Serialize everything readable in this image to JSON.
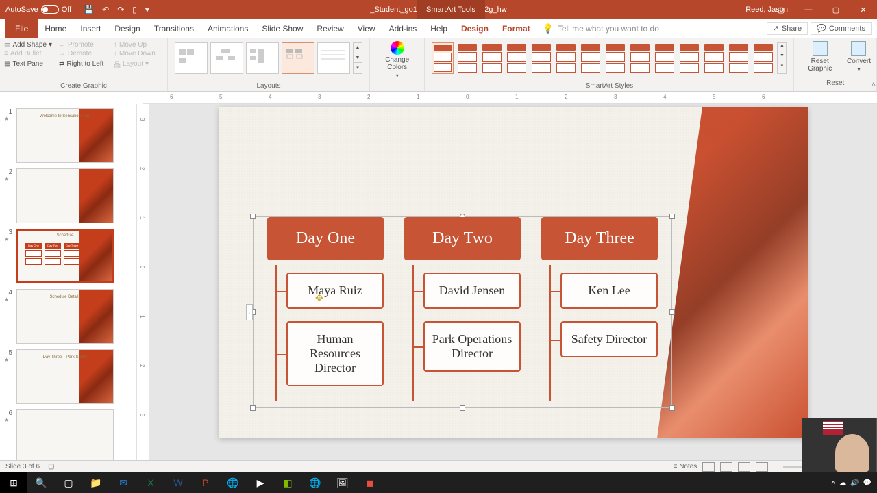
{
  "titlebar": {
    "autosave_label": "AutoSave",
    "autosave_state": "Off",
    "doc_name": "_Student_go16_pp_ch02_grader_2g_hw",
    "tools_tab": "SmartArt Tools",
    "user": "Reed, Jason"
  },
  "tabs": {
    "file": "File",
    "home": "Home",
    "insert": "Insert",
    "design": "Design",
    "transitions": "Transitions",
    "animations": "Animations",
    "slideshow": "Slide Show",
    "review": "Review",
    "view": "View",
    "addins": "Add-ins",
    "help": "Help",
    "ctx_design": "Design",
    "ctx_format": "Format",
    "tellme": "Tell me what you want to do",
    "share": "Share",
    "comments": "Comments"
  },
  "ribbon": {
    "create_graphic": {
      "label": "Create Graphic",
      "add_shape": "Add Shape",
      "add_bullet": "Add Bullet",
      "text_pane": "Text Pane",
      "promote": "Promote",
      "demote": "Demote",
      "rtl": "Right to Left",
      "move_up": "Move Up",
      "move_down": "Move Down",
      "layout": "Layout"
    },
    "layouts_label": "Layouts",
    "change_colors": "Change Colors",
    "styles_label": "SmartArt Styles",
    "reset": {
      "label": "Reset",
      "reset_graphic": "Reset Graphic",
      "convert": "Convert"
    }
  },
  "ruler_h": [
    "6",
    "5",
    "4",
    "3",
    "2",
    "1",
    "0",
    "1",
    "2",
    "3",
    "4",
    "5",
    "6"
  ],
  "ruler_v": [
    "3",
    "2",
    "1",
    "0",
    "1",
    "2",
    "3"
  ],
  "thumbnails": [
    {
      "num": "1",
      "title": "Welcome to Sensation Park"
    },
    {
      "num": "2",
      "title": ""
    },
    {
      "num": "3",
      "title": "Schedule"
    },
    {
      "num": "4",
      "title": "Schedule Details"
    },
    {
      "num": "5",
      "title": "Day Three—Park Safety"
    },
    {
      "num": "6",
      "title": ""
    }
  ],
  "slide": {
    "title": "Schedule",
    "smartart": {
      "columns": [
        {
          "header": "Day One",
          "children": [
            "Maya Ruiz",
            "Human Resources Director"
          ]
        },
        {
          "header": "Day Two",
          "children": [
            "David Jensen",
            "Park Operations Director"
          ]
        },
        {
          "header": "Day Three",
          "children": [
            "Ken Lee",
            "Safety Director"
          ]
        }
      ]
    }
  },
  "status": {
    "slide_counter": "Slide 3 of 6",
    "notes": "Notes"
  },
  "mini_days": [
    "Day One",
    "Day Two",
    "Day Three"
  ]
}
